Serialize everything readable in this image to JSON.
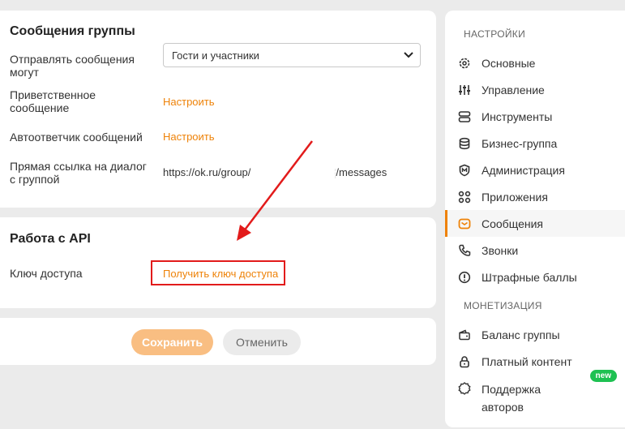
{
  "messages_section": {
    "title": "Сообщения группы",
    "who_can_send_label": "Отправлять сообщения могут",
    "who_can_send_value": "Гости и участники",
    "greeting_label": "Приветственное сообщение",
    "greeting_action": "Настроить",
    "autoresponder_label": "Автоответчик сообщений",
    "autoresponder_action": "Настроить",
    "direct_link_label": "Прямая ссылка на диалог с группой",
    "direct_link_prefix": "https://ok.ru/group/",
    "direct_link_suffix": "/messages"
  },
  "api_section": {
    "title": "Работа с API",
    "access_key_label": "Ключ доступа",
    "access_key_action": "Получить ключ доступа"
  },
  "buttons": {
    "save": "Сохранить",
    "cancel": "Отменить"
  },
  "sidebar": {
    "settings_heading": "НАСТРОЙКИ",
    "monetization_heading": "МОНЕТИЗАЦИЯ",
    "items": [
      {
        "label": "Основные",
        "icon": "gear-icon"
      },
      {
        "label": "Управление",
        "icon": "sliders-icon"
      },
      {
        "label": "Инструменты",
        "icon": "tools-icon"
      },
      {
        "label": "Бизнес-группа",
        "icon": "database-icon"
      },
      {
        "label": "Администрация",
        "icon": "admin-shield-icon"
      },
      {
        "label": "Приложения",
        "icon": "apps-grid-icon"
      },
      {
        "label": "Сообщения",
        "icon": "mail-icon",
        "active": true
      },
      {
        "label": "Звонки",
        "icon": "phone-icon"
      },
      {
        "label": "Штрафные баллы",
        "icon": "warning-circle-icon"
      }
    ],
    "monetization_items": [
      {
        "label": "Баланс группы",
        "icon": "wallet-icon"
      },
      {
        "label": "Платный контент",
        "icon": "lock-icon"
      },
      {
        "label": "Поддержка авторов",
        "icon": "badge-icon",
        "badge": "new"
      }
    ]
  },
  "colors": {
    "accent": "#ee8208",
    "highlight_border": "#e21b1b",
    "badge_green": "#1ec152"
  }
}
